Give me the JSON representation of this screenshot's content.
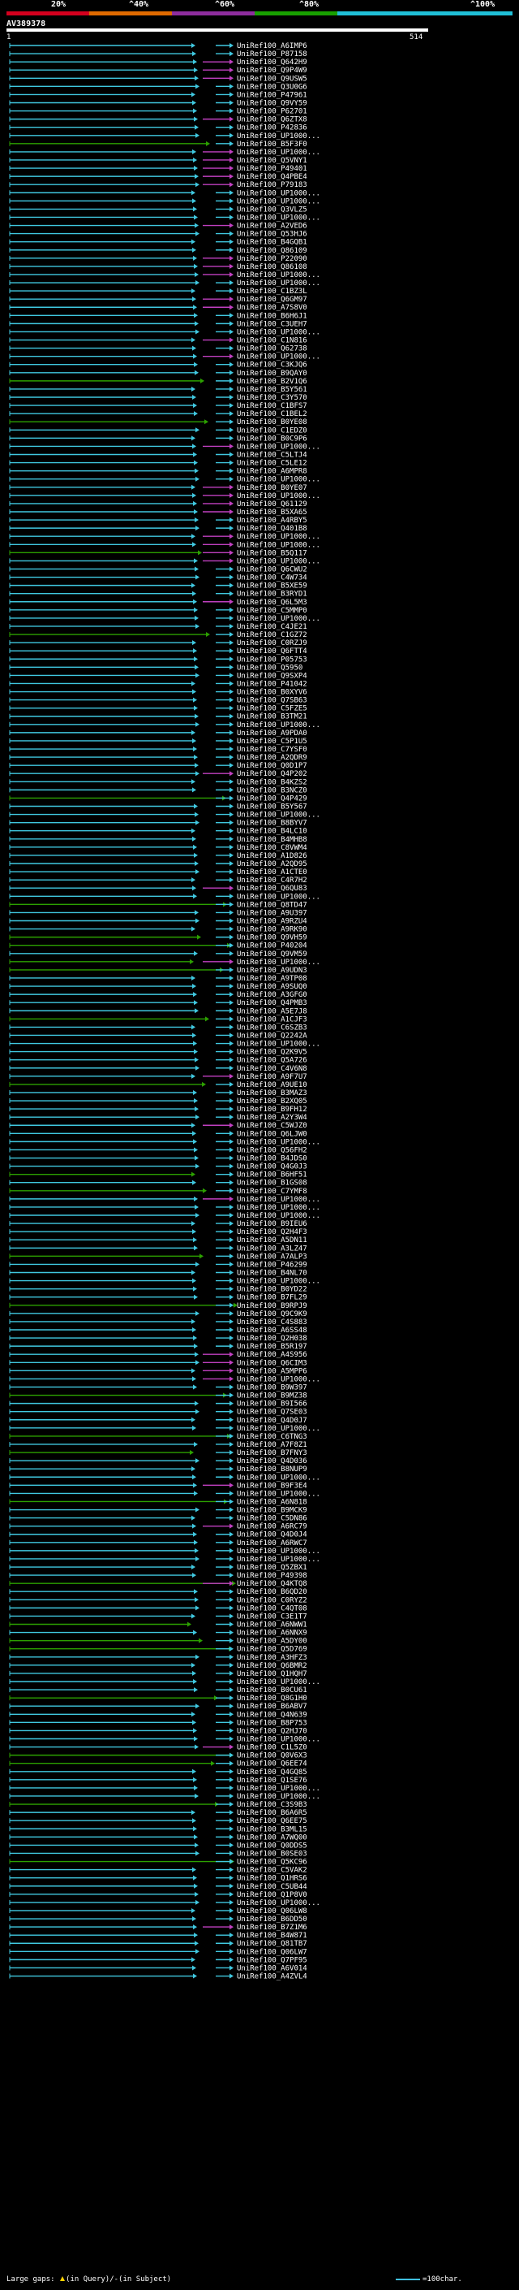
{
  "colors": {
    "scale": [
      "#d4001e",
      "#e06a00",
      "#8e2d9e",
      "#18a000",
      "#20c0d8"
    ],
    "cyan": "#40c8e0",
    "green": "#2ca000",
    "magenta": "#c040c0",
    "yellow": "#ffd200"
  },
  "scale_labels": [
    "20%",
    "^40%",
    "^60%",
    "^80%",
    "^100%"
  ],
  "query": {
    "id": "AV389378",
    "start": "1",
    "end": "514"
  },
  "footer": {
    "large_gaps": "Large gaps:",
    "in_query": "(in Query)",
    "in_subject": "/-(in Subject)",
    "scale": "=100char."
  },
  "hits": [
    "UniRef100_A6IMP6",
    "UniRef100_P87158",
    "UniRef100_Q642H9",
    "UniRef100_Q9P4W9",
    "UniRef100_Q9USW5",
    "UniRef100_Q3U0G6",
    "UniRef100_P47961",
    "UniRef100_Q9VY59",
    "UniRef100_P62701",
    "UniRef100_Q6ZTX8",
    "UniRef100_P42836",
    "UniRef100_UP1000...",
    "UniRef100_B5F3F0",
    "UniRef100_UP1000...",
    "UniRef100_Q5VNY1",
    "UniRef100_P49401",
    "UniRef100_Q4PBE4",
    "UniRef100_P79183",
    "UniRef100_UP1000...",
    "UniRef100_UP1000...",
    "UniRef100_Q3VLZ5",
    "UniRef100_UP1000...",
    "UniRef100_A2VED6",
    "UniRef100_Q53HJ6",
    "UniRef100_B4GQB1",
    "UniRef100_Q86109",
    "UniRef100_P22090",
    "UniRef100_Q86108",
    "UniRef100_UP1000...",
    "UniRef100_UP1000...",
    "UniRef100_C1BZ3L",
    "UniRef100_Q6GM97",
    "UniRef100_A7S8V0",
    "UniRef100_B6H6J1",
    "UniRef100_C3UEH7",
    "UniRef100_UP1000...",
    "UniRef100_C1N816",
    "UniRef100_Q62738",
    "UniRef100_UP1000...",
    "UniRef100_C3KJQ6",
    "UniRef100_B9QAY0",
    "UniRef100_B2V1Q6",
    "UniRef100_B5Y561",
    "UniRef100_C3Y570",
    "UniRef100_C1BFS7",
    "UniRef100_C1BEL2",
    "UniRef100_B0YE08",
    "UniRef100_C1EDZ0",
    "UniRef100_B0C9P6",
    "UniRef100_UP1000...",
    "UniRef100_C5LTJ4",
    "UniRef100_C5LE12",
    "UniRef100_A6MPR8",
    "UniRef100_UP1000...",
    "UniRef100_B0YE07",
    "UniRef100_UP1000...",
    "UniRef100_Q61129",
    "UniRef100_B5XA65",
    "UniRef100_A4RBY5",
    "UniRef100_Q401B8",
    "UniRef100_UP1000...",
    "UniRef100_UP1000...",
    "UniRef100_B5Q117",
    "UniRef100_UP1000...",
    "UniRef100_Q6CWU2",
    "UniRef100_C4W734",
    "UniRef100_B5XE59",
    "UniRef100_B3RYD1",
    "UniRef100_Q6L5M3",
    "UniRef100_C5MMP0",
    "UniRef100_UP1000...",
    "UniRef100_C4JE21",
    "UniRef100_C1GZ72",
    "UniRef100_C0RZJ9",
    "UniRef100_Q6FTT4",
    "UniRef100_P05753",
    "UniRef100_Q5950",
    "UniRef100_Q9SXP4",
    "UniRef100_P41042",
    "UniRef100_B0XYV6",
    "UniRef100_Q7SB63",
    "UniRef100_C5FZE5",
    "UniRef100_B3TM21",
    "UniRef100_UP1000...",
    "UniRef100_A9PDA0",
    "UniRef100_C5P1U5",
    "UniRef100_C7YSF0",
    "UniRef100_A2QDR9",
    "UniRef100_Q0D1P7",
    "UniRef100_Q4P202",
    "UniRef100_B4KZS2",
    "UniRef100_B3NCZ0",
    "UniRef100_Q4P429",
    "UniRef100_B5Y567",
    "UniRef100_UP1000...",
    "UniRef100_B8BYV7",
    "UniRef100_B4LC10",
    "UniRef100_B4MHB8",
    "UniRef100_C8VWM4",
    "UniRef100_A1D826",
    "UniRef100_A2QD95",
    "UniRef100_A1CTE0",
    "UniRef100_C4R7H2",
    "UniRef100_Q6QU83",
    "UniRef100_UP1000...",
    "UniRef100_Q8TD47",
    "UniRef100_A9U397",
    "UniRef100_A9RZU4",
    "UniRef100_A9RK90",
    "UniRef100_Q9VH59",
    "UniRef100_P40204",
    "UniRef100_Q9VM59",
    "UniRef100_UP1000...",
    "UniRef100_A9UDN3",
    "UniRef100_A9TP08",
    "UniRef100_A9SUQ0",
    "UniRef100_A3GFG0",
    "UniRef100_Q4PMB3",
    "UniRef100_A5E7J8",
    "UniRef100_A1CJF3",
    "UniRef100_C6SZB3",
    "UniRef100_Q2242A",
    "UniRef100_UP1000...",
    "UniRef100_Q2K9V5",
    "UniRef100_Q5A726",
    "UniRef100_C4V6N8",
    "UniRef100_A9F7U7",
    "UniRef100_A9UE10",
    "UniRef100_B3MAZ3",
    "UniRef100_B2XQ05",
    "UniRef100_B9FH12",
    "UniRef100_A2Y3W4",
    "UniRef100_C5WJZ0",
    "UniRef100_Q6LJW0",
    "UniRef100_UP1000...",
    "UniRef100_Q56FH2",
    "UniRef100_B4JDS0",
    "UniRef100_Q4G0J3",
    "UniRef100_B6HF51",
    "UniRef100_B1GS08",
    "UniRef100_C7YMF8",
    "UniRef100_UP1000...",
    "UniRef100_UP1000...",
    "UniRef100_UP1000...",
    "UniRef100_B9IEU6",
    "UniRef100_Q2H4F3",
    "UniRef100_A5DN11",
    "UniRef100_A3LZ47",
    "UniRef100_A7ALP3",
    "UniRef100_P46299",
    "UniRef100_B4NL70",
    "UniRef100_UP1000...",
    "UniRef100_B0YD22",
    "UniRef100_B7FL29",
    "UniRef100_B9RPJ9",
    "UniRef100_Q9C9K9",
    "UniRef100_C4S883",
    "UniRef100_A6SS48",
    "UniRef100_Q2H038",
    "UniRef100_B5R197",
    "UniRef100_A4S956",
    "UniRef100_Q6CIM3",
    "UniRef100_A5MPP6",
    "UniRef100_UP1000...",
    "UniRef100_B9W397",
    "UniRef100_B9MZ38",
    "UniRef100_B9I566",
    "UniRef100_Q7SE03",
    "UniRef100_Q4D0J7",
    "UniRef100_UP1000...",
    "UniRef100_C6TNG3",
    "UniRef100_A7F8Z1",
    "UniRef100_B7FNY3",
    "UniRef100_Q4D036",
    "UniRef100_B8NUP9",
    "UniRef100_UP1000...",
    "UniRef100_B9F3E4",
    "UniRef100_UP1000...",
    "UniRef100_A6N818",
    "UniRef100_B9MCK9",
    "UniRef100_C5DN86",
    "UniRef100_A6RC79",
    "UniRef100_Q4D0J4",
    "UniRef100_A6RWC7",
    "UniRef100_UP1000...",
    "UniRef100_UP1000...",
    "UniRef100_Q5ZBX1",
    "UniRef100_P49398",
    "UniRef100_Q4KTQ8",
    "UniRef100_B6QD20",
    "UniRef100_C0RYZ2",
    "UniRef100_C4QT08",
    "UniRef100_C3E1T7",
    "UniRef100_A6NWW1",
    "UniRef100_A6NNX9",
    "UniRef100_A5DY00",
    "UniRef100_Q5D769",
    "UniRef100_A3HFZ3",
    "UniRef100_Q6BMR2",
    "UniRef100_Q1HQH7",
    "UniRef100_UP1000...",
    "UniRef100_B0CU61",
    "UniRef100_Q8G1H0",
    "UniRef100_B6ABV7",
    "UniRef100_Q4N639",
    "UniRef100_B8P753",
    "UniRef100_Q2HJ70",
    "UniRef100_UP1000...",
    "UniRef100_C1L5Z0",
    "UniRef100_Q0V6X3",
    "UniRef100_Q6EE74",
    "UniRef100_Q4GQ85",
    "UniRef100_Q1SE76",
    "UniRef100_UP1000...",
    "UniRef100_UP1000...",
    "UniRef100_C3S9B3",
    "UniRef100_B6A6R5",
    "UniRef100_Q6EE75",
    "UniRef100_B3ML15",
    "UniRef100_A7WQ00",
    "UniRef100_Q0DDS5",
    "UniRef100_B0SE03",
    "UniRef100_Q5KC96",
    "UniRef100_C5VAK2",
    "UniRef100_Q1HRS6",
    "UniRef100_C5UB44",
    "UniRef100_Q1P8V0",
    "UniRef100_UP1000...",
    "UniRef100_Q06LW8",
    "UniRef100_B6DD50",
    "UniRef100_B7Z1M6",
    "UniRef100_B4W871",
    "UniRef100_Q81TB7",
    "UniRef100_Q06LW7",
    "UniRef100_Q7PF95",
    "UniRef100_A6V014",
    "UniRef100_A4ZVL4"
  ]
}
